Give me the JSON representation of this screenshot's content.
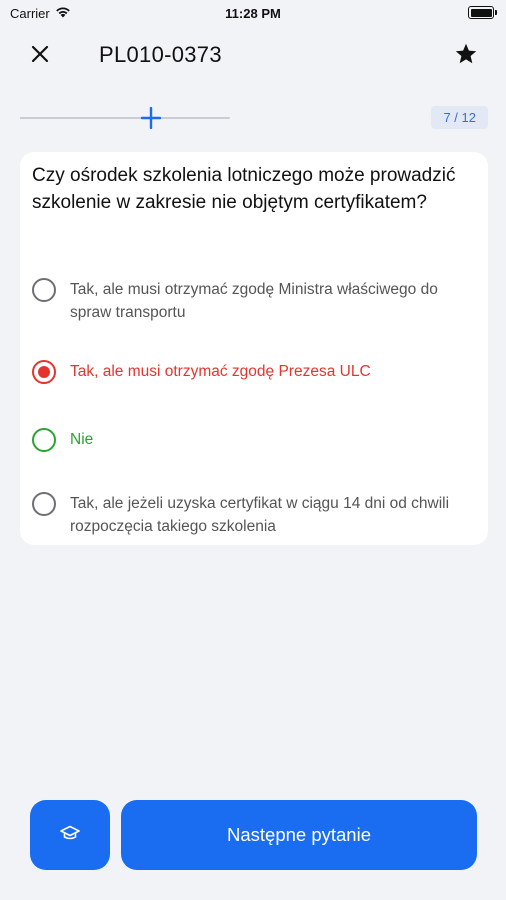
{
  "status_bar": {
    "carrier": "Carrier",
    "time": "11:28 PM",
    "icons": [
      "wifi-icon",
      "battery-icon"
    ]
  },
  "nav": {
    "title": "PL010-0373",
    "close_icon": "close-icon",
    "favorite_icon": "star-icon"
  },
  "progress": {
    "counter": "7 / 12",
    "fraction": 0.583
  },
  "question": {
    "text": "Czy ośrodek szkolenia lotniczego może prowadzić szkolenie w zakresie nie objętym certyfikatem?",
    "answers": [
      {
        "text": "Tak, ale musi otrzymać zgodę Ministra właściwego do spraw transportu",
        "state": "neutral"
      },
      {
        "text": "Tak, ale musi otrzymać zgodę Prezesa ULC",
        "state": "selected-wrong"
      },
      {
        "text": "Nie",
        "state": "correct"
      },
      {
        "text": "Tak, ale jeżeli uzyska certyfikat w ciągu 14 dni od chwili rozpoczęcia takiego szkolenia",
        "state": "neutral"
      }
    ]
  },
  "footer": {
    "learn_icon": "graduation-cap-icon",
    "next_label": "Następne pytanie"
  },
  "colors": {
    "accent": "#1a6cf0",
    "wrong": "#e5342e",
    "correct": "#29a331",
    "background": "#f2f3f7"
  }
}
